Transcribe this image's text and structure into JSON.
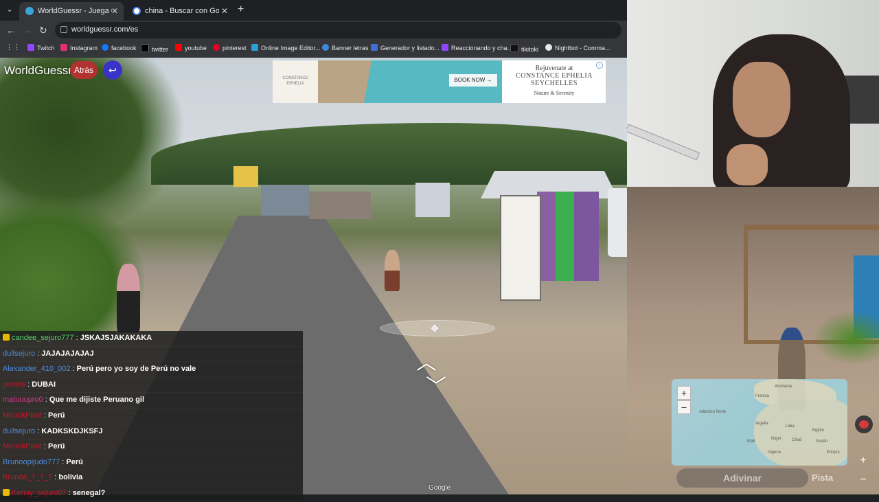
{
  "browser": {
    "tabs": [
      {
        "title": "WorldGuessr - Juega GeoGues",
        "active": true
      },
      {
        "title": "china - Buscar con Google",
        "active": false
      }
    ],
    "new_tab_label": "+",
    "url": "worldguessr.com/es",
    "bookmarks": [
      {
        "label": "Twitch",
        "color": "#9146ff"
      },
      {
        "label": "Instagram",
        "color": "#e1306c"
      },
      {
        "label": "facebook",
        "color": "#1877f2"
      },
      {
        "label": "twitter",
        "color": "#000000"
      },
      {
        "label": "youtube",
        "color": "#ff0000"
      },
      {
        "label": "pinterest",
        "color": "#e60023"
      },
      {
        "label": "Online Image Editor...",
        "color": "#2aa0d8"
      },
      {
        "label": "Banner letras",
        "color": "#3f8ad8"
      },
      {
        "label": "Generador y listado...",
        "color": "#3f6fd8"
      },
      {
        "label": "Reaccionando y cha...",
        "color": "#9146ff"
      },
      {
        "label": "tikitoki",
        "color": "#111111"
      },
      {
        "label": "Nightbot - Comma...",
        "color": "#e8e8e8"
      }
    ]
  },
  "game": {
    "logo": "WorldGuessr",
    "back_label": "Atrás",
    "return_icon": "↩",
    "google_label": "Google",
    "guess_label": "Adivinar",
    "hint_label": "Pista",
    "zoom_in": "+",
    "zoom_out": "−",
    "side_plus": "+",
    "side_minus": "−"
  },
  "ad": {
    "brand": "CONSTANCE EPHELIA",
    "button": "BOOK NOW →",
    "line1": "Rejuvenate at",
    "line2": "CONSTANCE EPHELIA",
    "line3": "SEYCHELLES",
    "line4": "Nature & Serenity"
  },
  "map_labels": [
    "Alemania",
    "Francia",
    "Atlántico Norte",
    "Argelia",
    "Libia",
    "Egipto",
    "Malí",
    "Níger",
    "Chad",
    "Sudán",
    "Nigeria",
    "Etiopía"
  ],
  "chat": [
    {
      "user": "candee_sejuro777",
      "color": "#5ad16e",
      "msg": "JSKAJSJAKAKAKA",
      "badge": "#e6b800"
    },
    {
      "user": "dullsejuro",
      "color": "#4c8de0",
      "msg": "JAJAJAJAJAJ"
    },
    {
      "user": "Alexander_410_002",
      "color": "#4c8de0",
      "msg": "Perú pero yo soy de Perú no vale"
    },
    {
      "user": "pomrls",
      "color": "#c0182a",
      "msg": "DUBAI"
    },
    {
      "user": "matuuupro0",
      "color": "#d23a8a",
      "msg": "Que me dijiste Peruano gil"
    },
    {
      "user": "MiruokPixel",
      "color": "#c0182a",
      "msg": "Perú"
    },
    {
      "user": "dullsejuro",
      "color": "#4c8de0",
      "msg": "KADKSKDJKSFJ"
    },
    {
      "user": "MiruokPixel",
      "color": "#c0182a",
      "msg": "Perú"
    },
    {
      "user": "Brunoopijudo777",
      "color": "#4c8de0",
      "msg": "Perú"
    },
    {
      "user": "Brunda_7_7_7",
      "color": "#c0182a",
      "msg": "bolivia"
    },
    {
      "user": "Kenny_sejuro07",
      "color": "#c0182a",
      "msg": "senegal?",
      "badge": "#e6b800"
    }
  ]
}
